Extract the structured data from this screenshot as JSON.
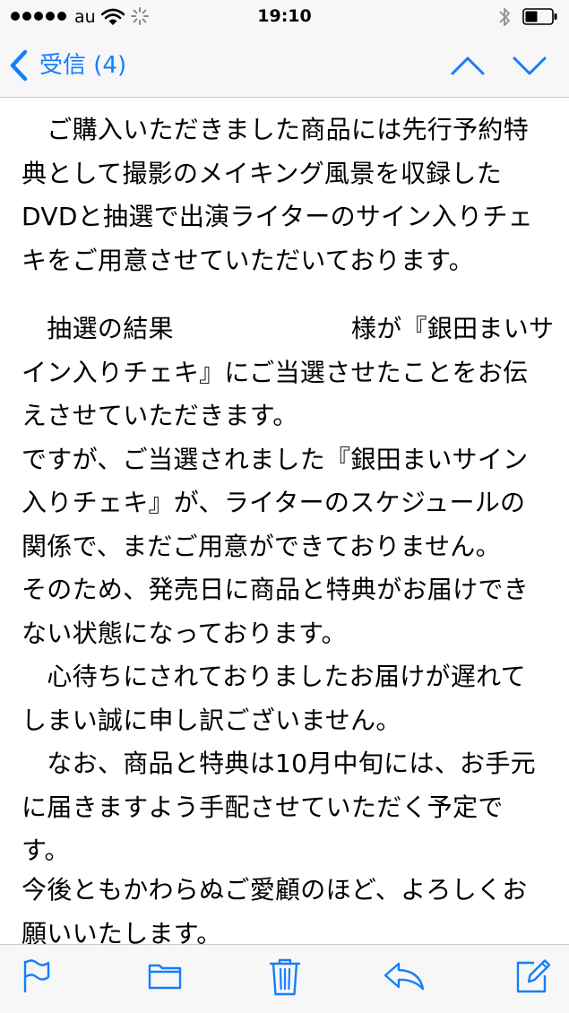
{
  "status_bar": {
    "carrier": "au",
    "time": "19:10"
  },
  "nav": {
    "back_label": "受信 (4)"
  },
  "message": {
    "paragraph1": "　ご購入いただきました商品には先行予約特\n典として撮影のメイキング風景を収録した\nDVDと抽選で出演ライターのサイン入りチェ\nキをご用意させていただいております。",
    "paragraph2": "　抽選の結果　　　　　　　様が『銀田まいサ\nイン入りチェキ』にご当選させたことをお伝\nえさせていただきます。\nですが、ご当選されました『銀田まいサイン\n入りチェキ』が、ライターのスケジュールの\n関係で、まだご用意ができておりません。\nそのため、発売日に商品と特典がお届けでき\nない状態になっております。\n　心待ちにされておりましたお届けが遅れて\nしまい誠に申し訳ございません。\n　なお、商品と特典は10月中旬には、お手元\nに届きますよう手配させていただく予定で\nす。",
    "paragraph3": "今後ともかわらぬご愛顧のほど、よろしくお\n願いいたします。"
  },
  "colors": {
    "accent": "#157efb",
    "bar_background": "#f7f7f7"
  },
  "icons": {
    "back": "chevron-left-icon",
    "previous": "chevron-up-icon",
    "next": "chevron-down-icon",
    "flag": "flag-icon",
    "folder": "folder-icon",
    "trash": "trash-icon",
    "reply": "reply-icon",
    "compose": "compose-icon"
  }
}
